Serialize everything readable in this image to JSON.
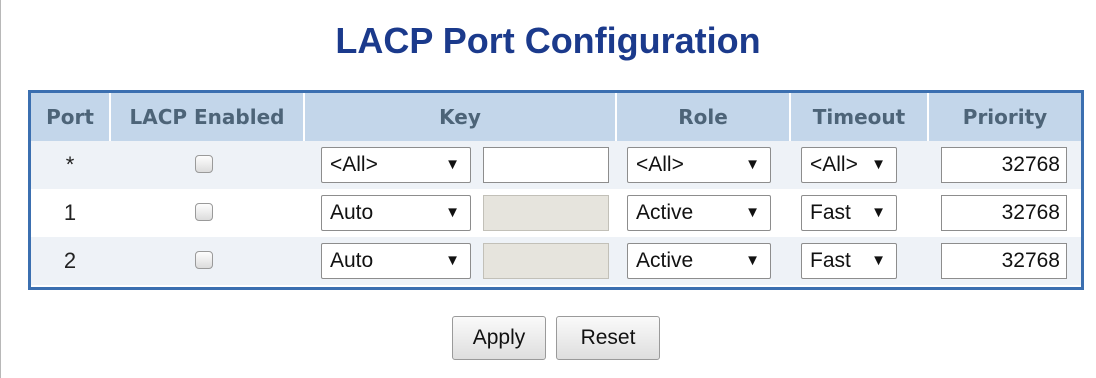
{
  "page": {
    "title": "LACP Port Configuration"
  },
  "table": {
    "headers": {
      "port": "Port",
      "lacp_enabled": "LACP Enabled",
      "key": "Key",
      "role": "Role",
      "timeout": "Timeout",
      "priority": "Priority"
    },
    "rows": [
      {
        "port": "*",
        "lacp_enabled": false,
        "key_mode": "<All>",
        "key_value": "",
        "key_value_disabled": false,
        "role": "<All>",
        "timeout": "<All>",
        "priority": "32768"
      },
      {
        "port": "1",
        "lacp_enabled": false,
        "key_mode": "Auto",
        "key_value": "",
        "key_value_disabled": true,
        "role": "Active",
        "timeout": "Fast",
        "priority": "32768"
      },
      {
        "port": "2",
        "lacp_enabled": false,
        "key_mode": "Auto",
        "key_value": "",
        "key_value_disabled": true,
        "role": "Active",
        "timeout": "Fast",
        "priority": "32768"
      }
    ],
    "dropdown_arrow": "▼"
  },
  "buttons": {
    "apply": "Apply",
    "reset": "Reset"
  },
  "colors": {
    "title": "#1b3a8c",
    "table_border": "#3b6fb0",
    "header_bg": "#c3d6ea",
    "alt_row_bg": "#eef2f7"
  }
}
